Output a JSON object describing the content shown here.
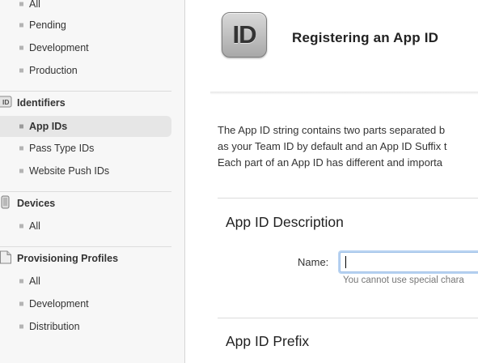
{
  "sidebar": {
    "certificates_items": [
      {
        "label": "All"
      },
      {
        "label": "Pending"
      },
      {
        "label": "Development"
      },
      {
        "label": "Production"
      }
    ],
    "identifiers": {
      "header": "Identifiers",
      "icon_text": "ID",
      "items": [
        {
          "label": "App IDs",
          "active": true
        },
        {
          "label": "Pass Type IDs"
        },
        {
          "label": "Website Push IDs"
        }
      ]
    },
    "devices": {
      "header": "Devices",
      "items": [
        {
          "label": "All"
        }
      ]
    },
    "provisioning": {
      "header": "Provisioning Profiles",
      "items": [
        {
          "label": "All"
        },
        {
          "label": "Development"
        },
        {
          "label": "Distribution"
        }
      ]
    }
  },
  "main": {
    "icon_text": "ID",
    "title": "Registering an App ID",
    "intro_lines": [
      "The App ID string contains two parts separated b",
      "as your Team ID by default and an App ID Suffix t",
      "Each part of an App ID has different and importa"
    ],
    "description_section": {
      "title": "App ID Description",
      "name_label": "Name:",
      "name_value": "",
      "help_text": "You cannot use special chara"
    },
    "prefix_section": {
      "title": "App ID Prefix"
    }
  },
  "colors": {
    "sidebar_bg": "#f7f7f7",
    "active_item_bg": "#e6e6e6",
    "input_focus": "#bad4f2"
  }
}
